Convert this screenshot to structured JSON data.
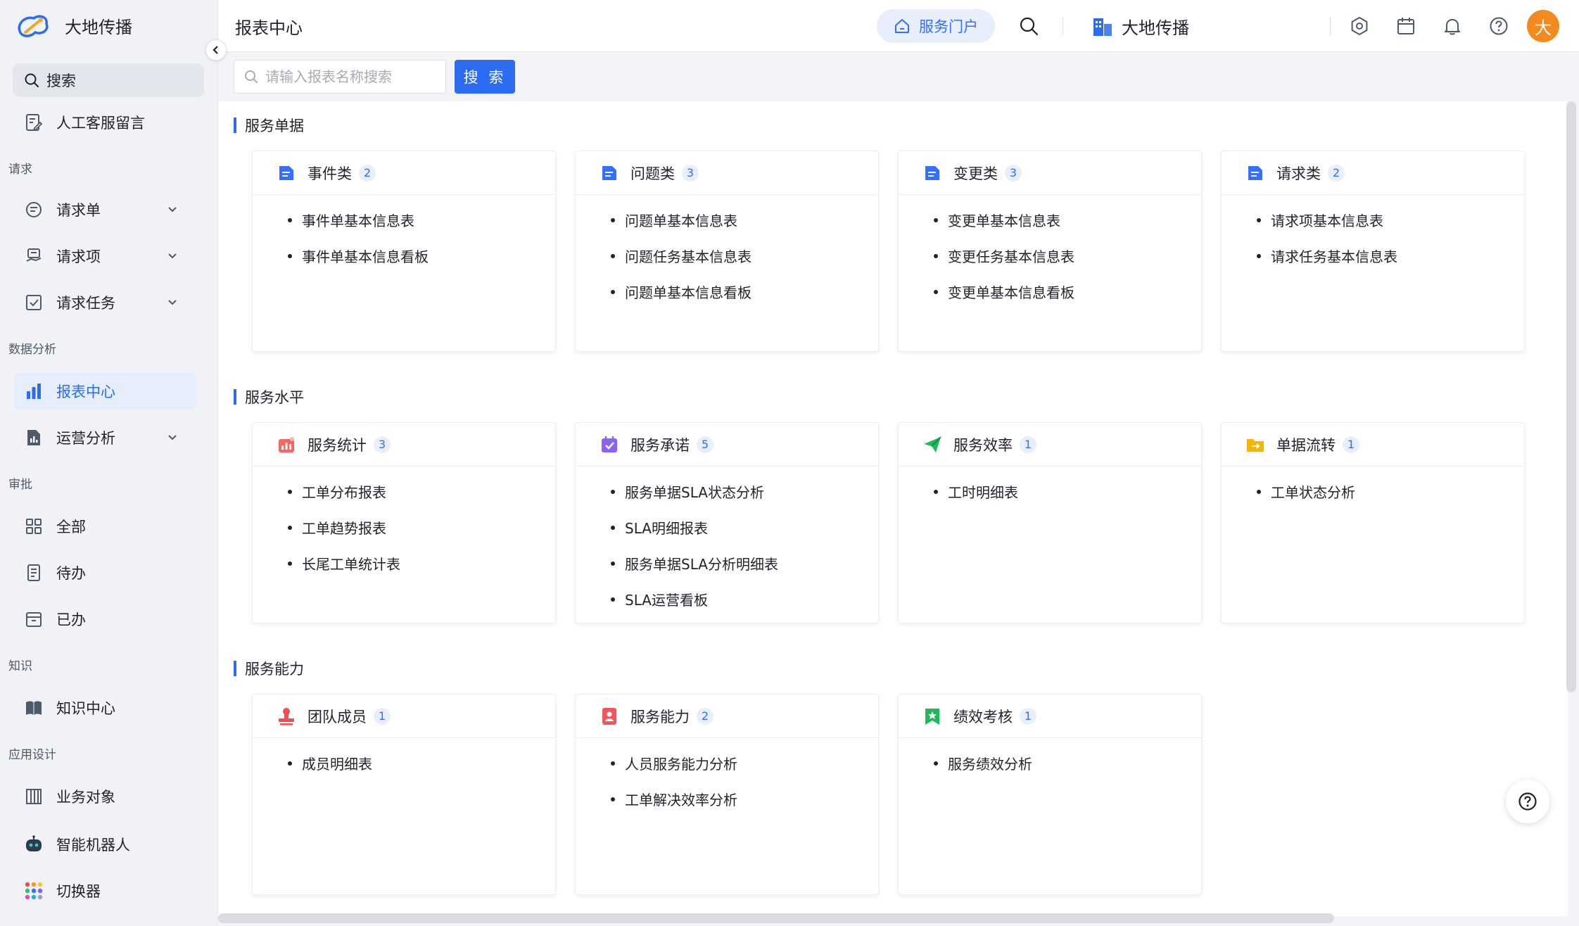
{
  "app": {
    "brand": "大地传播"
  },
  "sidebar": {
    "search_label": "搜索",
    "top_item": {
      "label": "人工客服留言",
      "icon": "message-edit-icon"
    },
    "groups": [
      {
        "label": "请求",
        "items": [
          {
            "label": "请求单",
            "icon": "chat-list-icon",
            "expandable": true
          },
          {
            "label": "请求项",
            "icon": "request-item-icon",
            "expandable": true
          },
          {
            "label": "请求任务",
            "icon": "task-check-icon",
            "expandable": true
          }
        ]
      },
      {
        "label": "数据分析",
        "items": [
          {
            "label": "报表中心",
            "icon": "bar-chart-icon",
            "active": true
          },
          {
            "label": "运营分析",
            "icon": "report-doc-icon",
            "expandable": true
          }
        ]
      },
      {
        "label": "审批",
        "items": [
          {
            "label": "全部",
            "icon": "grid-icon"
          },
          {
            "label": "待办",
            "icon": "todo-doc-icon"
          },
          {
            "label": "已办",
            "icon": "archive-box-icon"
          }
        ]
      },
      {
        "label": "知识",
        "items": [
          {
            "label": "知识中心",
            "icon": "book-icon"
          }
        ]
      },
      {
        "label": "应用设计",
        "items": [
          {
            "label": "业务对象",
            "icon": "building-icon"
          },
          {
            "label": "智能机器人",
            "icon": "robot-icon"
          },
          {
            "label": "切换器",
            "icon": "app-switcher-icon"
          }
        ]
      }
    ]
  },
  "header": {
    "title": "报表中心",
    "portal_label": "服务门户",
    "org_name": "大地传播",
    "avatar_text": "大"
  },
  "toolbar": {
    "search_placeholder": "请输入报表名称搜索",
    "search_button": "搜 索"
  },
  "sections": [
    {
      "title": "服务单据",
      "cards": [
        {
          "title": "事件类",
          "count": "2",
          "icon": "document-icon",
          "items": [
            "事件单基本信息表",
            "事件单基本信息看板"
          ]
        },
        {
          "title": "问题类",
          "count": "3",
          "icon": "document-icon",
          "items": [
            "问题单基本信息表",
            "问题任务基本信息表",
            "问题单基本信息看板"
          ]
        },
        {
          "title": "变更类",
          "count": "3",
          "icon": "document-icon",
          "items": [
            "变更单基本信息表",
            "变更任务基本信息表",
            "变更单基本信息看板"
          ]
        },
        {
          "title": "请求类",
          "count": "2",
          "icon": "document-icon",
          "items": [
            "请求项基本信息表",
            "请求任务基本信息表"
          ]
        }
      ]
    },
    {
      "title": "服务水平",
      "cards": [
        {
          "title": "服务统计",
          "count": "3",
          "icon": "stats-chart-icon",
          "items": [
            "工单分布报表",
            "工单趋势报表",
            "长尾工单统计表"
          ]
        },
        {
          "title": "服务承诺",
          "count": "5",
          "icon": "calendar-check-icon",
          "items": [
            "服务单据SLA状态分析",
            "SLA明细报表",
            "服务单据SLA分析明细表",
            "SLA运营看板"
          ]
        },
        {
          "title": "服务效率",
          "count": "1",
          "icon": "paper-plane-icon",
          "items": [
            "工时明细表"
          ]
        },
        {
          "title": "单据流转",
          "count": "1",
          "icon": "folder-transfer-icon",
          "items": [
            "工单状态分析"
          ]
        }
      ]
    },
    {
      "title": "服务能力",
      "cards": [
        {
          "title": "团队成员",
          "count": "1",
          "icon": "stamp-icon",
          "items": [
            "成员明细表"
          ]
        },
        {
          "title": "服务能力",
          "count": "2",
          "icon": "badge-person-icon",
          "items": [
            "人员服务能力分析",
            "工单解决效率分析"
          ]
        },
        {
          "title": "绩效考核",
          "count": "1",
          "icon": "bookmark-star-icon",
          "items": [
            "服务绩效分析"
          ]
        }
      ]
    }
  ]
}
